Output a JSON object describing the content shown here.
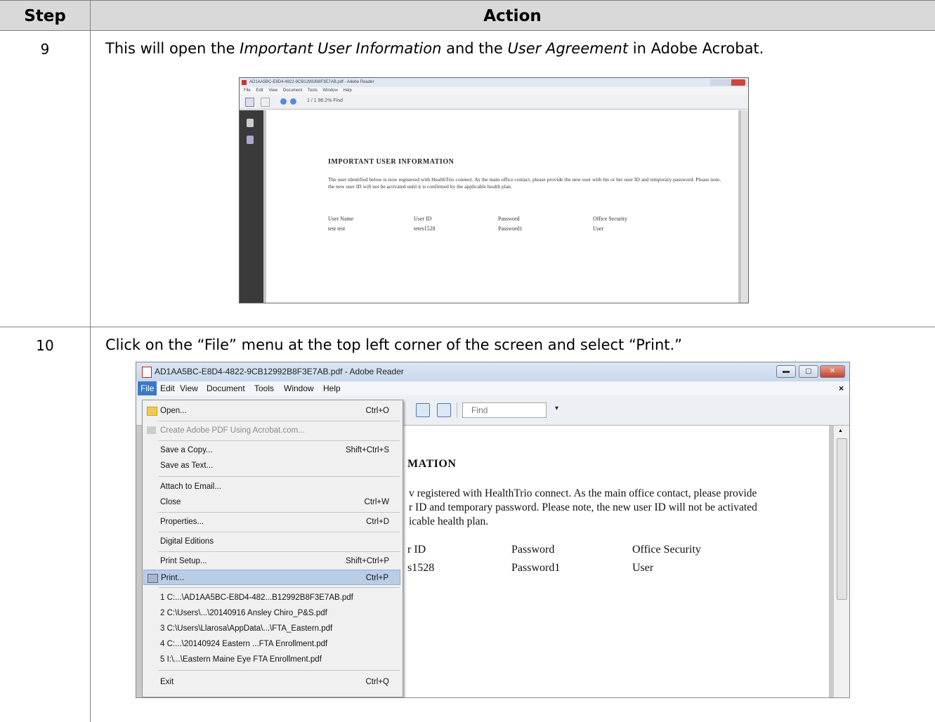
{
  "header": {
    "step": "Step",
    "action": "Action"
  },
  "rows": [
    {
      "step": "9",
      "text_a": "This will open the ",
      "text_em1": "Important User Information",
      "text_b": " and the ",
      "text_em2": "User Agreement",
      "text_c": " in Adobe Acrobat."
    },
    {
      "step": "10",
      "text": "Click on the “File” menu at the top left corner of the screen and select “Print.”"
    }
  ],
  "shot1": {
    "title": "AD1AA5BC-E8D4-4822-9CB12992B8F3E7AB.pdf - Adobe Reader",
    "menu": "File Edit View Document Tools Window Help",
    "toolbar": "1 / 1   96.2%   Find",
    "heading": "IMPORTANT USER INFORMATION",
    "paragraph": "The user identified below is now registered with HealthTrio connect. As the main office contact, please provide the new user with his or her user ID and temporary password. Please note, the new user ID will not be activated until it is confirmed by the applicable health plan.",
    "cols": [
      "User Name",
      "User ID",
      "Password",
      "Office Security"
    ],
    "vals": [
      "test test",
      "tetes1528",
      "Password1",
      "User"
    ]
  },
  "shot2": {
    "title": "AD1AA5BC-E8D4-4822-9CB12992B8F3E7AB.pdf - Adobe Reader",
    "menus": [
      "File",
      "Edit",
      "View",
      "Document",
      "Tools",
      "Window",
      "Help"
    ],
    "close_x": "×",
    "find_placeholder": "Find",
    "heading_frag": "MATION",
    "para_lines": [
      "v registered with HealthTrio connect. As the main office contact, please provide",
      "r ID and temporary password. Please note, the new user ID will not be activated",
      "icable health plan."
    ],
    "cols": [
      "r ID",
      "Password",
      "Office Security"
    ],
    "vals": [
      "s1528",
      "Password1",
      "User"
    ],
    "file_menu": [
      {
        "label": "Open...",
        "shortcut": "Ctrl+O"
      },
      {
        "label": "Create Adobe PDF Using Acrobat.com...",
        "shortcut": ""
      },
      {
        "label": "Save a Copy...",
        "shortcut": "Shift+Ctrl+S"
      },
      {
        "label": "Save as Text...",
        "shortcut": ""
      },
      {
        "label": "Attach to Email...",
        "shortcut": ""
      },
      {
        "label": "Close",
        "shortcut": "Ctrl+W"
      },
      {
        "label": "Properties...",
        "shortcut": "Ctrl+D"
      },
      {
        "label": "Digital Editions",
        "shortcut": ""
      },
      {
        "label": "Print Setup...",
        "shortcut": "Shift+Ctrl+P"
      },
      {
        "label": "Print...",
        "shortcut": "Ctrl+P"
      },
      {
        "label": "1 C:...\\AD1AA5BC-E8D4-482...B12992B8F3E7AB.pdf",
        "shortcut": ""
      },
      {
        "label": "2 C:\\Users\\...\\20140916 Ansley Chiro_P&S.pdf",
        "shortcut": ""
      },
      {
        "label": "3 C:\\Users\\Llarosa\\AppData\\...\\FTA_Eastern.pdf",
        "shortcut": ""
      },
      {
        "label": "4 C:...\\20140924 Eastern ...FTA Enrollment.pdf",
        "shortcut": ""
      },
      {
        "label": "5 I:\\...\\Eastern Maine Eye FTA Enrollment.pdf",
        "shortcut": ""
      },
      {
        "label": "Exit",
        "shortcut": "Ctrl+Q"
      }
    ]
  }
}
